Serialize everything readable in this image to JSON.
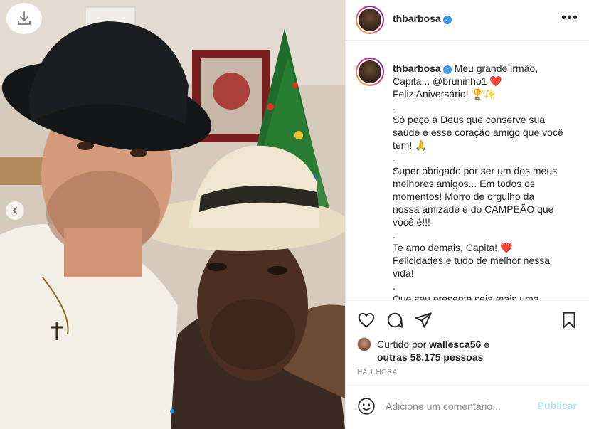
{
  "post": {
    "username": "thbarbosa",
    "more_icon": "more-options-icon",
    "caption_lines": [
      "Meu grande irmão,",
      "Capita... @bruninho1 ❤️",
      "Feliz Aniversário! 🏆✨",
      ".",
      "Só peço a Deus que conserve sua",
      "saúde e esse coração amigo que você",
      "tem! 🙏",
      ".",
      "Super obrigado por ser um dos meus",
      "melhores amigos... Em todos os",
      "momentos! Morro de orgulho da",
      "nossa amizade e do CAMPEÃO que",
      "você é!!!",
      ".",
      "Te amo demais, Capita! ❤️",
      "Felicidades e tudo de melhor nessa",
      "vida!",
      ".",
      "Que seu presente seja mais uma"
    ],
    "likes": {
      "prefix": "Curtido por ",
      "liker": "wallesca56",
      "middle": " e",
      "others": "outras 58.175 pessoas"
    },
    "timestamp": "Há 1 hora",
    "comment": {
      "placeholder": "Adicione um comentário...",
      "publish_label": "Publicar"
    }
  },
  "photo": {
    "download_icon": "download-icon",
    "carousel_prev_icon": "chevron-left-icon",
    "carousel_dots": 2,
    "active_dot": 1
  },
  "colors": {
    "link_blue": "#0095f6",
    "publish_disabled": "#b2dffc",
    "muted": "#8e8e8e",
    "verified": "#3897f0",
    "heart_red": "#ed4956"
  }
}
